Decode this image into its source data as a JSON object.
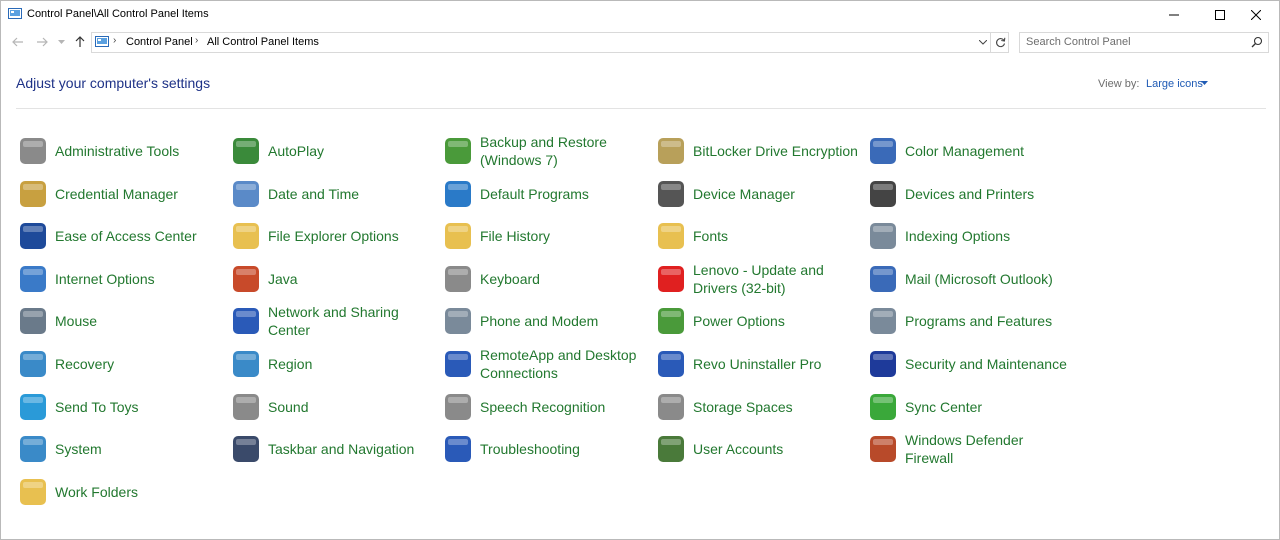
{
  "window": {
    "title": "Control Panel\\All Control Panel Items",
    "minimize_icon": "minimize-icon",
    "maximize_icon": "maximize-icon",
    "close_icon": "close-icon"
  },
  "nav": {
    "back_icon": "back-arrow-icon",
    "forward_icon": "forward-arrow-icon",
    "recent_icon": "chevron-down-icon",
    "up_icon": "up-arrow-icon"
  },
  "address": {
    "breadcrumbs": [
      "Control Panel",
      "All Control Panel Items"
    ],
    "refresh_icon": "refresh-icon"
  },
  "search": {
    "placeholder": "Search Control Panel"
  },
  "header": {
    "title": "Adjust your computer's settings",
    "view_by_label": "View by:",
    "view_by_value": "Large icons"
  },
  "colors": {
    "link_green": "#22782f",
    "heading_blue": "#1e3287",
    "accent_blue": "#1e5ab4"
  },
  "items": [
    {
      "label": "Administrative Tools",
      "icon": "admin-tools-icon",
      "color": "#8a8a8a"
    },
    {
      "label": "AutoPlay",
      "icon": "autoplay-icon",
      "color": "#3a8a3a"
    },
    {
      "label": "Backup and Restore (Windows 7)",
      "icon": "backup-restore-icon",
      "color": "#4a9a3a"
    },
    {
      "label": "BitLocker Drive Encryption",
      "icon": "bitlocker-icon",
      "color": "#b8a05a"
    },
    {
      "label": "Color Management",
      "icon": "color-management-icon",
      "color": "#3a6ab8"
    },
    {
      "label": "Credential Manager",
      "icon": "credential-manager-icon",
      "color": "#c8a040"
    },
    {
      "label": "Date and Time",
      "icon": "date-time-icon",
      "color": "#5a8ac8"
    },
    {
      "label": "Default Programs",
      "icon": "default-programs-icon",
      "color": "#2a7ac8"
    },
    {
      "label": "Device Manager",
      "icon": "device-manager-icon",
      "color": "#555555"
    },
    {
      "label": "Devices and Printers",
      "icon": "devices-printers-icon",
      "color": "#444444"
    },
    {
      "label": "Ease of Access Center",
      "icon": "ease-of-access-icon",
      "color": "#1e4a9a"
    },
    {
      "label": "File Explorer Options",
      "icon": "file-explorer-options-icon",
      "color": "#e8c050"
    },
    {
      "label": "File History",
      "icon": "file-history-icon",
      "color": "#e8c050"
    },
    {
      "label": "Fonts",
      "icon": "fonts-icon",
      "color": "#e8c050"
    },
    {
      "label": "Indexing Options",
      "icon": "indexing-options-icon",
      "color": "#7a8a9a"
    },
    {
      "label": "Internet Options",
      "icon": "internet-options-icon",
      "color": "#3a7ac8"
    },
    {
      "label": "Java",
      "icon": "java-icon",
      "color": "#c84a2a"
    },
    {
      "label": "Keyboard",
      "icon": "keyboard-icon",
      "color": "#8a8a8a"
    },
    {
      "label": "Lenovo - Update and Drivers (32-bit)",
      "icon": "lenovo-update-icon",
      "color": "#e02020"
    },
    {
      "label": "Mail (Microsoft Outlook)",
      "icon": "mail-outlook-icon",
      "color": "#3a6ab8"
    },
    {
      "label": "Mouse",
      "icon": "mouse-icon",
      "color": "#6a7a8a"
    },
    {
      "label": "Network and Sharing Center",
      "icon": "network-sharing-icon",
      "color": "#2a5ab8"
    },
    {
      "label": "Phone and Modem",
      "icon": "phone-modem-icon",
      "color": "#7a8a9a"
    },
    {
      "label": "Power Options",
      "icon": "power-options-icon",
      "color": "#4a9a3a"
    },
    {
      "label": "Programs and Features",
      "icon": "programs-features-icon",
      "color": "#7a8a9a"
    },
    {
      "label": "Recovery",
      "icon": "recovery-icon",
      "color": "#3a8ac8"
    },
    {
      "label": "Region",
      "icon": "region-icon",
      "color": "#3a8ac8"
    },
    {
      "label": "RemoteApp and Desktop Connections",
      "icon": "remoteapp-icon",
      "color": "#2a5ab8"
    },
    {
      "label": "Revo Uninstaller Pro",
      "icon": "revo-uninstaller-icon",
      "color": "#2a5ab8"
    },
    {
      "label": "Security and Maintenance",
      "icon": "security-maintenance-flag-icon",
      "color": "#1e3a9a"
    },
    {
      "label": "Send To Toys",
      "icon": "send-to-toys-icon",
      "color": "#2a9ad8"
    },
    {
      "label": "Sound",
      "icon": "sound-icon",
      "color": "#8a8a8a"
    },
    {
      "label": "Speech Recognition",
      "icon": "speech-recognition-icon",
      "color": "#8a8a8a"
    },
    {
      "label": "Storage Spaces",
      "icon": "storage-spaces-icon",
      "color": "#8a8a8a"
    },
    {
      "label": "Sync Center",
      "icon": "sync-center-icon",
      "color": "#3aa83a"
    },
    {
      "label": "System",
      "icon": "system-icon",
      "color": "#3a8ac8"
    },
    {
      "label": "Taskbar and Navigation",
      "icon": "taskbar-navigation-icon",
      "color": "#3a4a6a"
    },
    {
      "label": "Troubleshooting",
      "icon": "troubleshooting-icon",
      "color": "#2a5ab8"
    },
    {
      "label": "User Accounts",
      "icon": "user-accounts-icon",
      "color": "#4a7a3a"
    },
    {
      "label": "Windows Defender Firewall",
      "icon": "windows-firewall-icon",
      "color": "#b84a2a"
    },
    {
      "label": "Work Folders",
      "icon": "work-folders-icon",
      "color": "#e8c050"
    }
  ]
}
